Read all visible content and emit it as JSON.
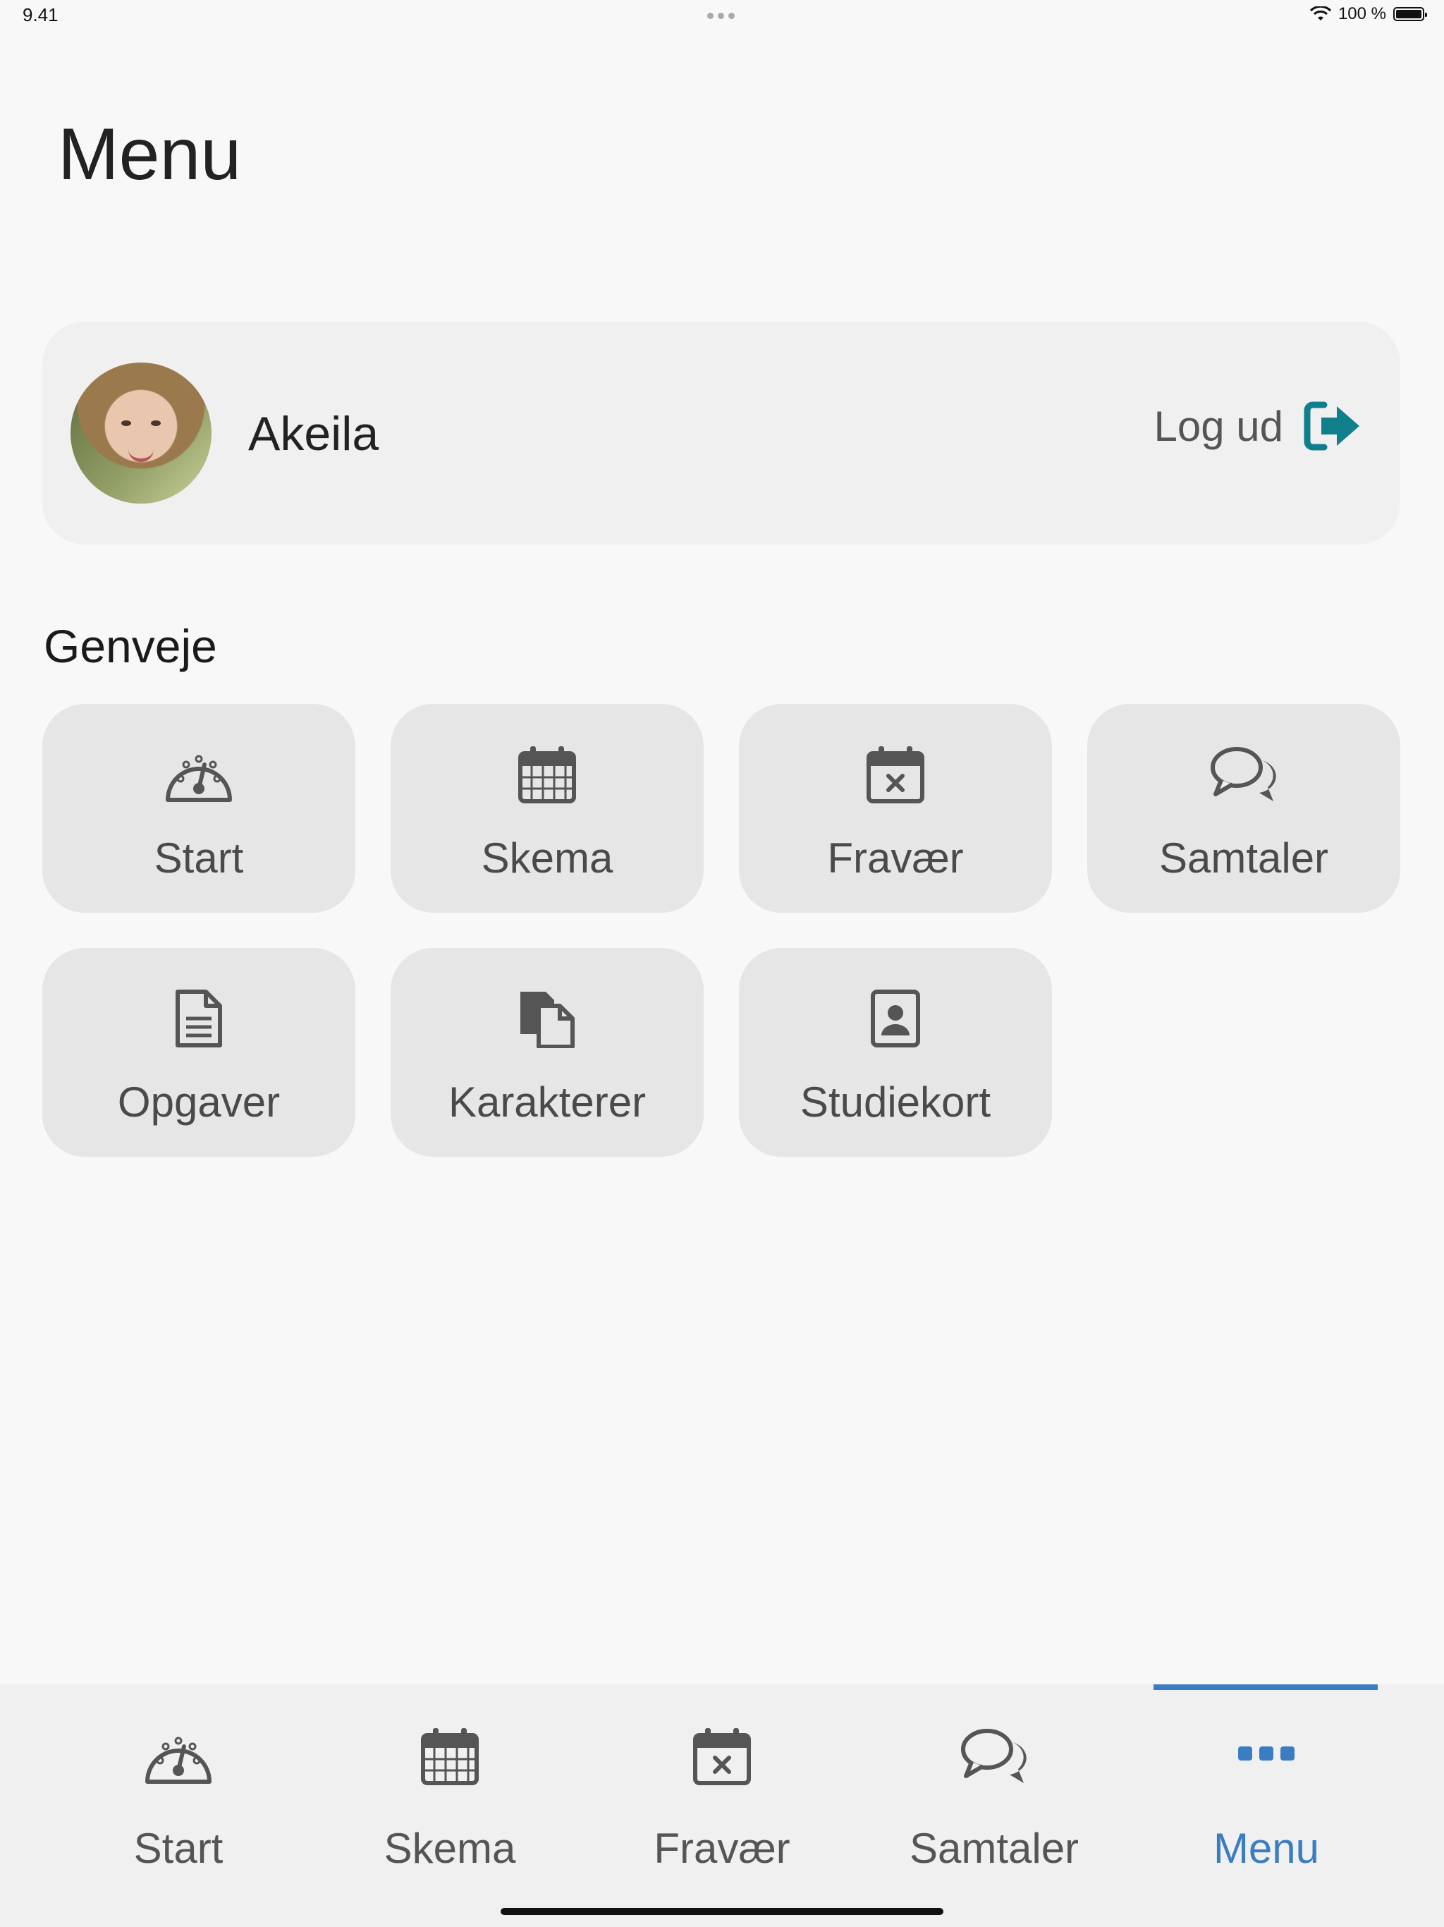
{
  "status_bar": {
    "time": "9.41",
    "battery": "100 %"
  },
  "page": {
    "title": "Menu"
  },
  "profile": {
    "name": "Akeila",
    "logout_label": "Log ud"
  },
  "shortcuts": {
    "title": "Genveje",
    "items": [
      {
        "label": "Start",
        "icon": "dashboard-icon"
      },
      {
        "label": "Skema",
        "icon": "calendar-icon"
      },
      {
        "label": "Fravær",
        "icon": "calendar-x-icon"
      },
      {
        "label": "Samtaler",
        "icon": "chat-icon"
      },
      {
        "label": "Opgaver",
        "icon": "document-icon"
      },
      {
        "label": "Karakterer",
        "icon": "documents-icon"
      },
      {
        "label": "Studiekort",
        "icon": "id-card-icon"
      }
    ]
  },
  "tabbar": {
    "items": [
      {
        "label": "Start",
        "icon": "dashboard-icon"
      },
      {
        "label": "Skema",
        "icon": "calendar-icon"
      },
      {
        "label": "Fravær",
        "icon": "calendar-x-icon"
      },
      {
        "label": "Samtaler",
        "icon": "chat-icon"
      },
      {
        "label": "Menu",
        "icon": "more-icon",
        "active": true
      }
    ]
  },
  "colors": {
    "accent": "#3a7dc2",
    "logout": "#0f7f8c",
    "icon": "#555555"
  }
}
